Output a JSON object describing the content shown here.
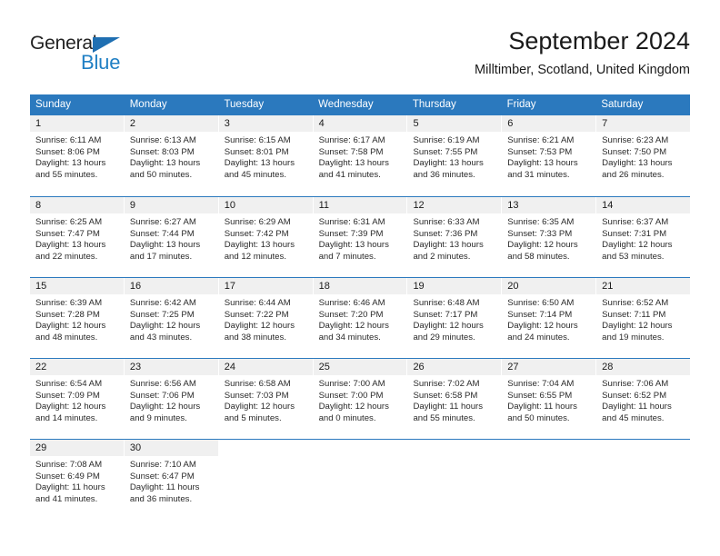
{
  "brand": {
    "name_top": "General",
    "name_bottom": "Blue",
    "color_primary": "#1F7FC4",
    "color_triangle": "#1F6FB2"
  },
  "header": {
    "title": "September 2024",
    "subtitle": "Milltimber, Scotland, United Kingdom"
  },
  "theme": {
    "header_blue": "#2B79BE",
    "day_band_gray": "#F0F0F0"
  },
  "weekdays": [
    "Sunday",
    "Monday",
    "Tuesday",
    "Wednesday",
    "Thursday",
    "Friday",
    "Saturday"
  ],
  "weeks": [
    [
      {
        "day": "1",
        "sunrise": "Sunrise: 6:11 AM",
        "sunset": "Sunset: 8:06 PM",
        "daylight": "Daylight: 13 hours and 55 minutes."
      },
      {
        "day": "2",
        "sunrise": "Sunrise: 6:13 AM",
        "sunset": "Sunset: 8:03 PM",
        "daylight": "Daylight: 13 hours and 50 minutes."
      },
      {
        "day": "3",
        "sunrise": "Sunrise: 6:15 AM",
        "sunset": "Sunset: 8:01 PM",
        "daylight": "Daylight: 13 hours and 45 minutes."
      },
      {
        "day": "4",
        "sunrise": "Sunrise: 6:17 AM",
        "sunset": "Sunset: 7:58 PM",
        "daylight": "Daylight: 13 hours and 41 minutes."
      },
      {
        "day": "5",
        "sunrise": "Sunrise: 6:19 AM",
        "sunset": "Sunset: 7:55 PM",
        "daylight": "Daylight: 13 hours and 36 minutes."
      },
      {
        "day": "6",
        "sunrise": "Sunrise: 6:21 AM",
        "sunset": "Sunset: 7:53 PM",
        "daylight": "Daylight: 13 hours and 31 minutes."
      },
      {
        "day": "7",
        "sunrise": "Sunrise: 6:23 AM",
        "sunset": "Sunset: 7:50 PM",
        "daylight": "Daylight: 13 hours and 26 minutes."
      }
    ],
    [
      {
        "day": "8",
        "sunrise": "Sunrise: 6:25 AM",
        "sunset": "Sunset: 7:47 PM",
        "daylight": "Daylight: 13 hours and 22 minutes."
      },
      {
        "day": "9",
        "sunrise": "Sunrise: 6:27 AM",
        "sunset": "Sunset: 7:44 PM",
        "daylight": "Daylight: 13 hours and 17 minutes."
      },
      {
        "day": "10",
        "sunrise": "Sunrise: 6:29 AM",
        "sunset": "Sunset: 7:42 PM",
        "daylight": "Daylight: 13 hours and 12 minutes."
      },
      {
        "day": "11",
        "sunrise": "Sunrise: 6:31 AM",
        "sunset": "Sunset: 7:39 PM",
        "daylight": "Daylight: 13 hours and 7 minutes."
      },
      {
        "day": "12",
        "sunrise": "Sunrise: 6:33 AM",
        "sunset": "Sunset: 7:36 PM",
        "daylight": "Daylight: 13 hours and 2 minutes."
      },
      {
        "day": "13",
        "sunrise": "Sunrise: 6:35 AM",
        "sunset": "Sunset: 7:33 PM",
        "daylight": "Daylight: 12 hours and 58 minutes."
      },
      {
        "day": "14",
        "sunrise": "Sunrise: 6:37 AM",
        "sunset": "Sunset: 7:31 PM",
        "daylight": "Daylight: 12 hours and 53 minutes."
      }
    ],
    [
      {
        "day": "15",
        "sunrise": "Sunrise: 6:39 AM",
        "sunset": "Sunset: 7:28 PM",
        "daylight": "Daylight: 12 hours and 48 minutes."
      },
      {
        "day": "16",
        "sunrise": "Sunrise: 6:42 AM",
        "sunset": "Sunset: 7:25 PM",
        "daylight": "Daylight: 12 hours and 43 minutes."
      },
      {
        "day": "17",
        "sunrise": "Sunrise: 6:44 AM",
        "sunset": "Sunset: 7:22 PM",
        "daylight": "Daylight: 12 hours and 38 minutes."
      },
      {
        "day": "18",
        "sunrise": "Sunrise: 6:46 AM",
        "sunset": "Sunset: 7:20 PM",
        "daylight": "Daylight: 12 hours and 34 minutes."
      },
      {
        "day": "19",
        "sunrise": "Sunrise: 6:48 AM",
        "sunset": "Sunset: 7:17 PM",
        "daylight": "Daylight: 12 hours and 29 minutes."
      },
      {
        "day": "20",
        "sunrise": "Sunrise: 6:50 AM",
        "sunset": "Sunset: 7:14 PM",
        "daylight": "Daylight: 12 hours and 24 minutes."
      },
      {
        "day": "21",
        "sunrise": "Sunrise: 6:52 AM",
        "sunset": "Sunset: 7:11 PM",
        "daylight": "Daylight: 12 hours and 19 minutes."
      }
    ],
    [
      {
        "day": "22",
        "sunrise": "Sunrise: 6:54 AM",
        "sunset": "Sunset: 7:09 PM",
        "daylight": "Daylight: 12 hours and 14 minutes."
      },
      {
        "day": "23",
        "sunrise": "Sunrise: 6:56 AM",
        "sunset": "Sunset: 7:06 PM",
        "daylight": "Daylight: 12 hours and 9 minutes."
      },
      {
        "day": "24",
        "sunrise": "Sunrise: 6:58 AM",
        "sunset": "Sunset: 7:03 PM",
        "daylight": "Daylight: 12 hours and 5 minutes."
      },
      {
        "day": "25",
        "sunrise": "Sunrise: 7:00 AM",
        "sunset": "Sunset: 7:00 PM",
        "daylight": "Daylight: 12 hours and 0 minutes."
      },
      {
        "day": "26",
        "sunrise": "Sunrise: 7:02 AM",
        "sunset": "Sunset: 6:58 PM",
        "daylight": "Daylight: 11 hours and 55 minutes."
      },
      {
        "day": "27",
        "sunrise": "Sunrise: 7:04 AM",
        "sunset": "Sunset: 6:55 PM",
        "daylight": "Daylight: 11 hours and 50 minutes."
      },
      {
        "day": "28",
        "sunrise": "Sunrise: 7:06 AM",
        "sunset": "Sunset: 6:52 PM",
        "daylight": "Daylight: 11 hours and 45 minutes."
      }
    ],
    [
      {
        "day": "29",
        "sunrise": "Sunrise: 7:08 AM",
        "sunset": "Sunset: 6:49 PM",
        "daylight": "Daylight: 11 hours and 41 minutes."
      },
      {
        "day": "30",
        "sunrise": "Sunrise: 7:10 AM",
        "sunset": "Sunset: 6:47 PM",
        "daylight": "Daylight: 11 hours and 36 minutes."
      },
      {
        "day": "",
        "sunrise": "",
        "sunset": "",
        "daylight": ""
      },
      {
        "day": "",
        "sunrise": "",
        "sunset": "",
        "daylight": ""
      },
      {
        "day": "",
        "sunrise": "",
        "sunset": "",
        "daylight": ""
      },
      {
        "day": "",
        "sunrise": "",
        "sunset": "",
        "daylight": ""
      },
      {
        "day": "",
        "sunrise": "",
        "sunset": "",
        "daylight": ""
      }
    ]
  ]
}
